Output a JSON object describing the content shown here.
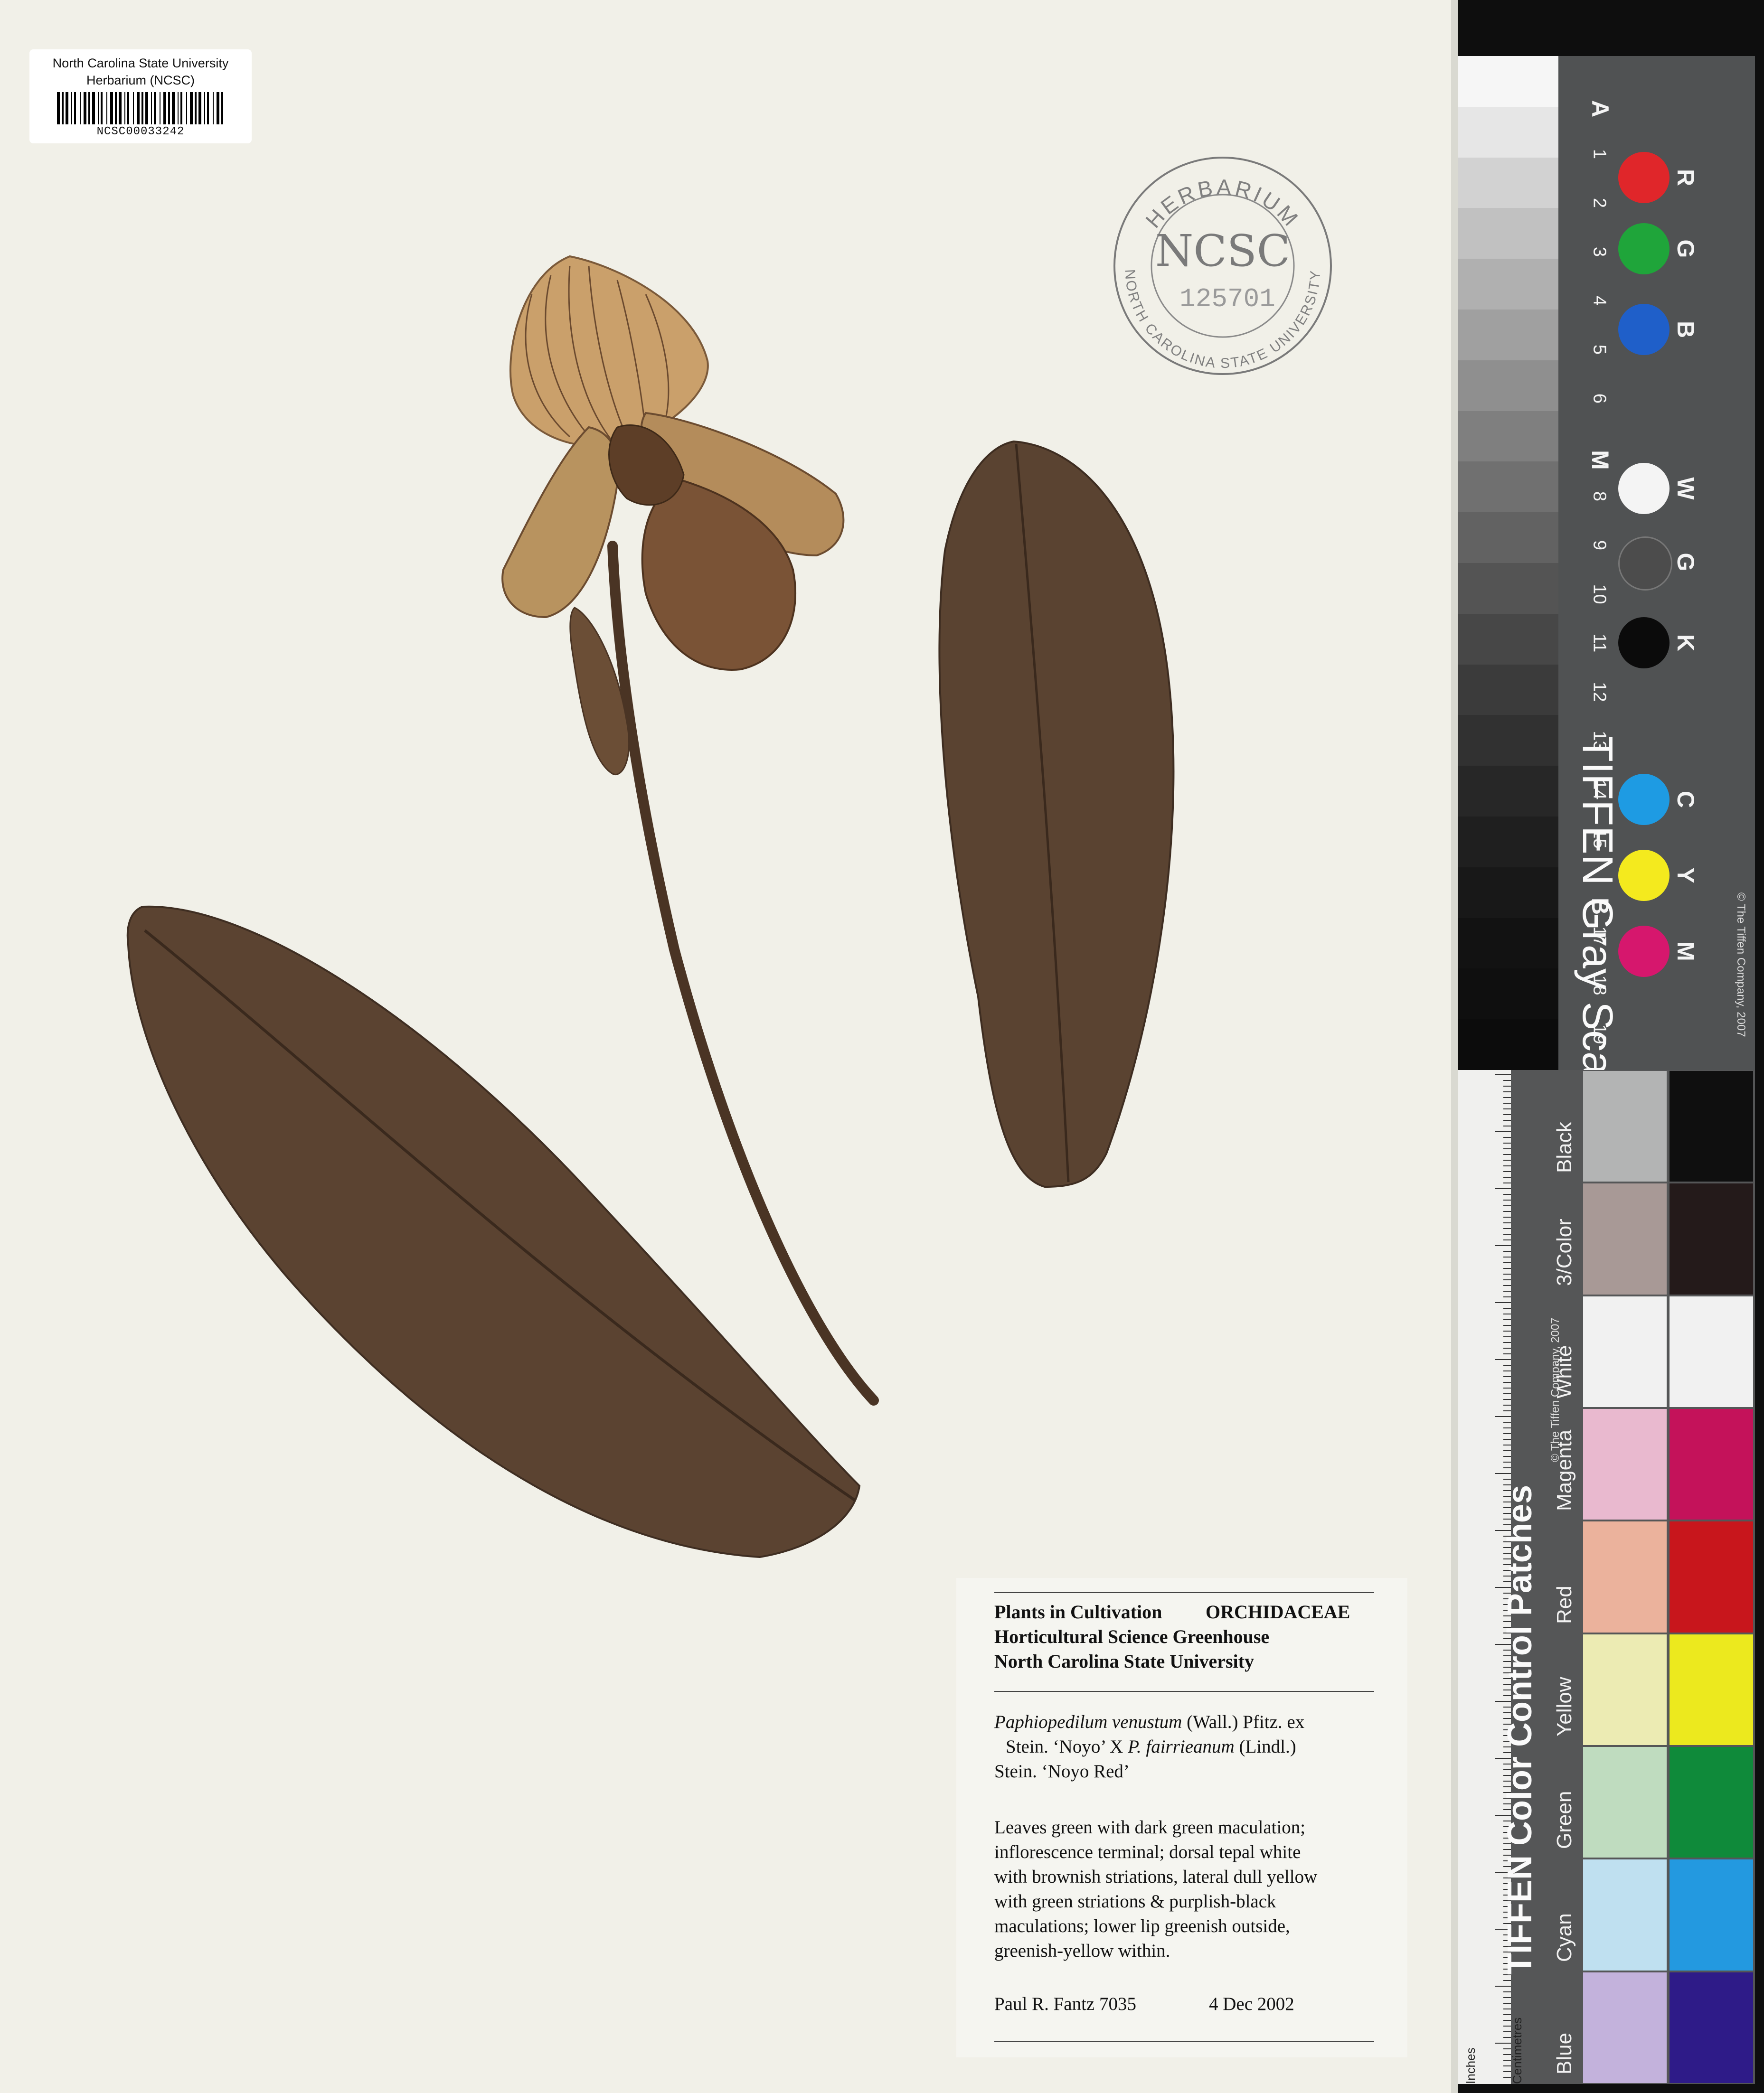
{
  "barcode_label": {
    "line1": "North Carolina State University",
    "line2": "Herbarium (NCSC)",
    "code": "NCSC00033242"
  },
  "stamp": {
    "top": "HERBARIUM",
    "center": "NCSC",
    "number": "125701",
    "bottom": "NORTH CAROLINA STATE UNIVERSITY"
  },
  "specimen": {
    "image_icon": "pressed-orchid-specimen",
    "leaf_color": "#5a4332",
    "flower_color": "#c9955a"
  },
  "label": {
    "header_left": "Plants in Cultivation",
    "family": "ORCHIDACEAE",
    "header_line2": "Horticultural Science Greenhouse",
    "header_line3": "North Carolina State University",
    "taxon_line1_italic": "Paphiopedilum venustum",
    "taxon_line1_rest": " (Wall.) Pfitz. ex",
    "taxon_line2_a": "Stein. ‘Noyo’ X ",
    "taxon_line2_italic": "P. fairrieanum",
    "taxon_line2_b": " (Lindl.)",
    "taxon_line3": "Stein. ‘Noyo Red’",
    "description": [
      "Leaves green with dark green maculation;",
      "inflorescence terminal; dorsal tepal white",
      "with brownish striations, lateral dull yellow",
      "with green striations & purplish-black",
      "maculations; lower lip greenish outside,",
      "greenish-yellow within."
    ],
    "collector": "Paul R. Fantz 7035",
    "date": "4 Dec 2002"
  },
  "gray_card": {
    "title": "TIFFEN Gray Scale",
    "copyright": "© The Tiffen Company, 2007",
    "letters": [
      "A",
      "M",
      "B"
    ],
    "numbers": [
      "1",
      "2",
      "3",
      "4",
      "5",
      "6",
      "8",
      "9",
      "10",
      "11",
      "12",
      "13",
      "14",
      "15",
      "17",
      "18",
      "19"
    ],
    "channels": [
      {
        "label": "R",
        "color": "#e0262a"
      },
      {
        "label": "G",
        "color": "#1fa53a"
      },
      {
        "label": "B",
        "color": "#1f5fc9"
      },
      {
        "label": "W",
        "color": "#f4f4f4"
      },
      {
        "label": "G",
        "color": "#4c4c4c"
      },
      {
        "label": "K",
        "color": "#0b0b0b"
      },
      {
        "label": "C",
        "color": "#1e9be3"
      },
      {
        "label": "Y",
        "color": "#f4ea1e"
      },
      {
        "label": "M",
        "color": "#d6176d"
      }
    ],
    "steps": [
      "#f6f6f6",
      "#e6e6e6",
      "#d2d2d2",
      "#c1c1c1",
      "#b0b0b0",
      "#a0a0a0",
      "#8f8f8f",
      "#7f7f7f",
      "#707070",
      "#626262",
      "#545454",
      "#474747",
      "#3b3b3b",
      "#313131",
      "#272727",
      "#1f1f1f",
      "#181818",
      "#121212",
      "#0f0f0f",
      "#0c0c0c"
    ]
  },
  "color_card": {
    "title": "TIFFEN Color Control Patches",
    "copyright": "© The Tiffen Company, 2007",
    "ruler_top": "Inches",
    "ruler_bottom": "Centimetres",
    "patches": [
      {
        "name": "Black",
        "a": "#b3b4b4",
        "b": "#0f0f0f"
      },
      {
        "name": "3/Color",
        "a": "#a89996",
        "b": "#241a1a"
      },
      {
        "name": "White",
        "a": "#f1f1f1",
        "b": "#f1f1f1"
      },
      {
        "name": "Magenta",
        "a": "#e9b9cf",
        "b": "#c4125a"
      },
      {
        "name": "Red",
        "a": "#ebb29c",
        "b": "#c8161c"
      },
      {
        "name": "Yellow",
        "a": "#ecebb3",
        "b": "#ece91e"
      },
      {
        "name": "Green",
        "a": "#bfdcbf",
        "b": "#0f8a3a"
      },
      {
        "name": "Cyan",
        "a": "#bfe0f0",
        "b": "#2399e0"
      },
      {
        "name": "Blue",
        "a": "#c3b2dc",
        "b": "#2e1b88"
      }
    ]
  }
}
